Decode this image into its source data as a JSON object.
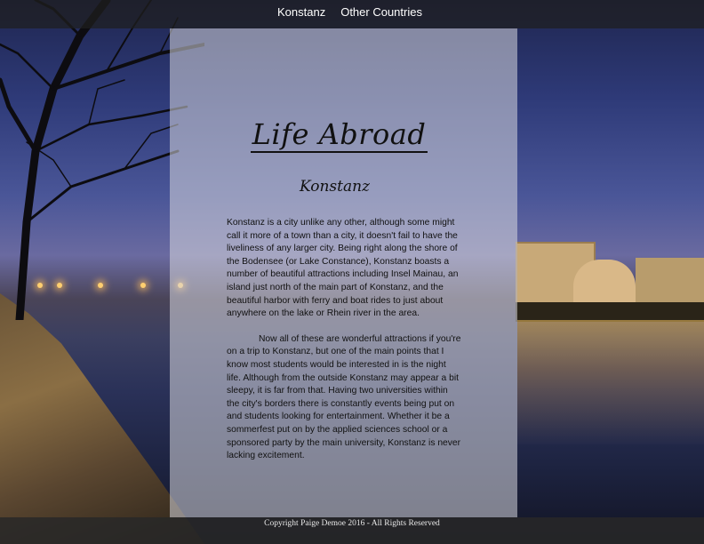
{
  "nav": {
    "items": [
      {
        "label": "Konstanz"
      },
      {
        "label": "Other Countries"
      }
    ]
  },
  "main": {
    "title": "Life Abroad",
    "subtitle": "Konstanz",
    "paragraphs": [
      "Konstanz is a city unlike any other, although some might call it more of a town than a city, it doesn't fail to have the liveliness of any larger city. Being right along the shore of the Bodensee (or Lake Constance), Konstanz boasts a number of beautiful attractions including Insel Mainau, an island just north of the main part of Konstanz, and the beautiful harbor with ferry and boat rides to just about anywhere on the lake or Rhein river in the area.",
      "Now all of these are wonderful attractions if you're on a trip to Konstanz, but one of the main points that I know most students would be interested in is the night life. Although from the outside Konstanz may appear a bit sleepy, it is far from that. Having two universities within the city's borders there is constantly events being put on and students looking for entertainment. Whether it be a sommerfest put on by the applied sciences school or a sponsored party by the main university, Konstanz is never lacking excitement."
    ]
  },
  "footer": {
    "copyright": "Copyright Paige Demoe 2016 - All Rights Reserved"
  }
}
